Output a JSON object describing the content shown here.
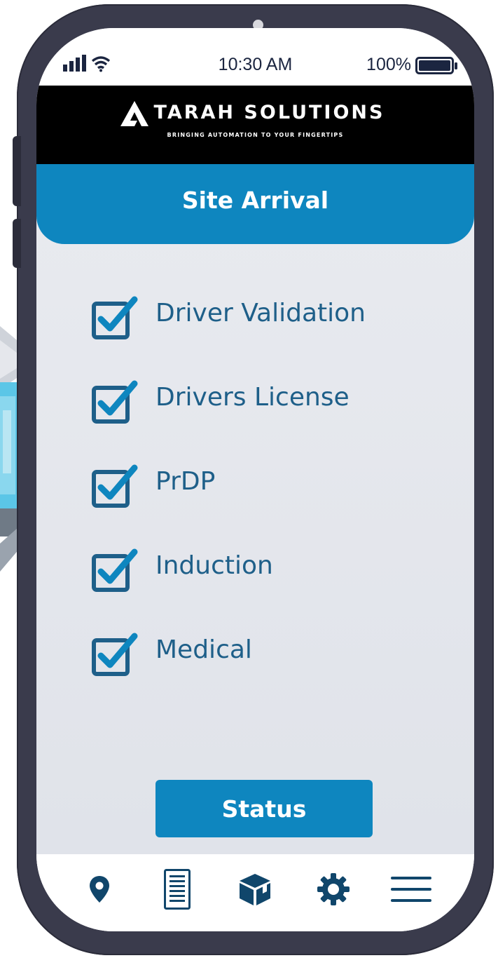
{
  "status_bar": {
    "time": "10:30 AM",
    "battery": "100%",
    "signal_icon": "signal-bars-icon",
    "wifi_icon": "wifi-icon",
    "battery_icon": "battery-full-icon"
  },
  "brand": {
    "name": "TARAH SOLUTIONS",
    "tagline": "BRINGING AUTOMATION TO YOUR FINGERTIPS",
    "logo_icon": "atarah-logo-a-icon"
  },
  "page": {
    "title": "Site Arrival"
  },
  "checklist": [
    {
      "label": "Driver Validation",
      "checked": true
    },
    {
      "label": "Drivers License",
      "checked": true
    },
    {
      "label": "PrDP",
      "checked": true
    },
    {
      "label": "Induction",
      "checked": true
    },
    {
      "label": "Medical",
      "checked": true
    }
  ],
  "actions": {
    "status_label": "Status"
  },
  "bottom_nav": [
    {
      "icon": "location-pin-icon"
    },
    {
      "icon": "document-list-icon"
    },
    {
      "icon": "package-box-icon"
    },
    {
      "icon": "settings-gear-icon"
    },
    {
      "icon": "hamburger-menu-icon"
    }
  ],
  "colors": {
    "accent": "#0e86bf",
    "text_blue": "#1e5f89",
    "phone_frame": "#3a3b4c",
    "brand_bar": "#000000",
    "content_bg": "#e8eaef"
  }
}
